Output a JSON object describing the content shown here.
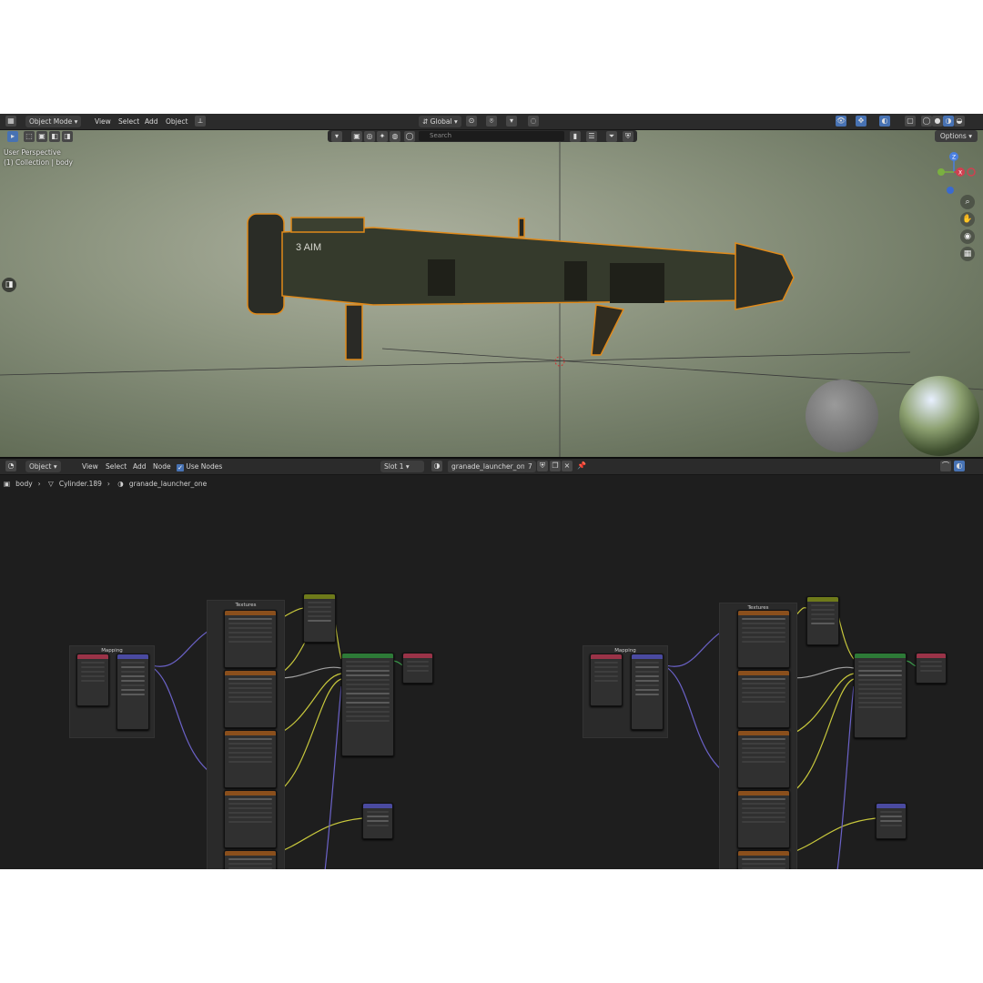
{
  "header": {
    "mode_label": "Object Mode",
    "menus": [
      "View",
      "Select",
      "Add",
      "Object"
    ],
    "orientation_label": "Global",
    "search_placeholder": "Search",
    "options_label": "Options"
  },
  "viewport": {
    "perspective_label": "User Perspective",
    "collection_label": "(1) Collection | body",
    "gizmo_axes": [
      "Z",
      "Y",
      "X"
    ]
  },
  "node_editor": {
    "mode_label": "Object",
    "menus": [
      "View",
      "Select",
      "Add",
      "Node"
    ],
    "use_nodes_label": "Use Nodes",
    "slot_label": "Slot 1",
    "material_name": "granade_launcher_one",
    "user_count": "7",
    "breadcrumb": [
      "body",
      "Cylinder.189",
      "granade_launcher_one"
    ],
    "frame_labels": [
      "Mapping",
      "Textures",
      "Mapping",
      "Textures"
    ]
  },
  "colors": {
    "texture_header": "#8a4f1c",
    "shader_header": "#2d7a37",
    "vector_header": "#4a4aa0",
    "wire_yellow": "#c8c83c",
    "wire_purple": "#6b62c8",
    "wire_grey": "#a0a0a0"
  }
}
